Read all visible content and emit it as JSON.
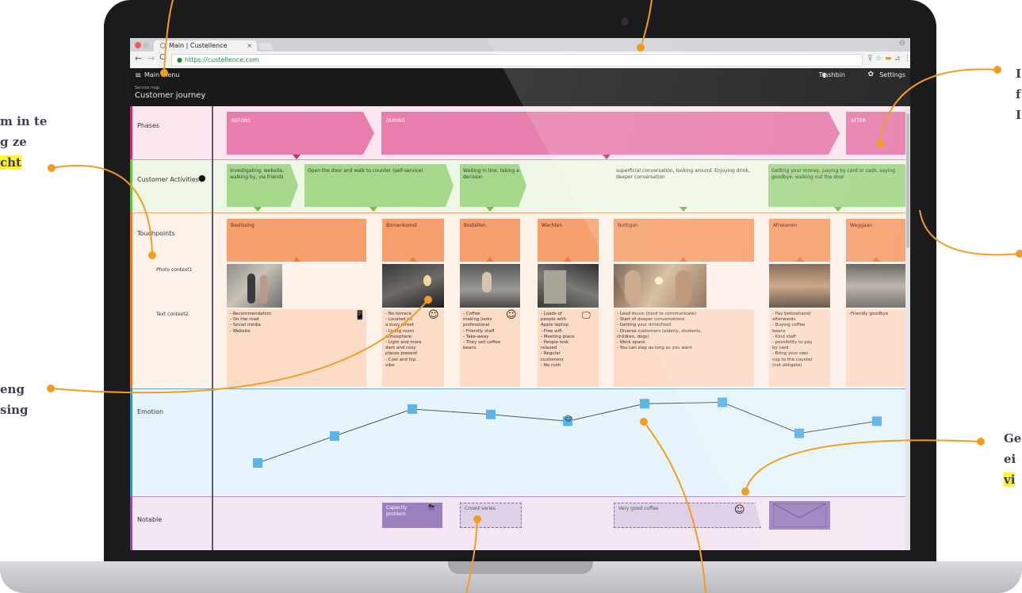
{
  "browser": {
    "tab_title": "Main | Custellence",
    "tab_close": "×",
    "url": "https://custellence.com",
    "profile_icon": "⊖",
    "nav_back": "←",
    "nav_forward": "→",
    "nav_reload": "C",
    "lock": "🔒",
    "ext_icons": [
      "⊽",
      "☆",
      "▬",
      "⊿",
      "⋮"
    ]
  },
  "app": {
    "menu_icon": "≡",
    "menu_label": "Main menu",
    "trash_icon": "▮",
    "trash_label": "Trashbin",
    "gear_icon": "✿",
    "settings_label": "Settings",
    "breadcrumb": "Service map",
    "page_title": "Customer journey"
  },
  "rows": {
    "phases": "Phases",
    "activities": "Customer Activities",
    "touchpoints": "Touchpoints",
    "photo_context": "Photo context1",
    "text_context": "Text context2",
    "emotion": "Emotion",
    "notable": "Notable"
  },
  "phases": [
    "BEFORE",
    "DURING",
    "AFTER"
  ],
  "activities": [
    "Investigating, website, walking by, via friends",
    "Open the door and walk to counter (self-service)",
    "Waiting in line, taking a decision",
    "superficial conversation, looking around. Enjoying drink, deeper conversation",
    "Getting your money, paying by card or cash, saying goodbye, walking out the door"
  ],
  "touchpoints": [
    {
      "title": "Beslissing",
      "icon": "📱",
      "text": "- Recommendation\n- On the road\n- Social media\n- Website"
    },
    {
      "title": "Binnenkomst",
      "icon": "☺",
      "text": "- No terrace\n- Located on\na busy street\n- Living room\natmosphere\n- Light and more\ndark and cosy\nplaces present\n- Cool and hip\nvibe"
    },
    {
      "title": "Bestellen",
      "icon": "☺",
      "text": "- Coffee\nmaking looks\nprofessional\n- Friendly staff\n- Take-away\n- They sell coffee\nbeans"
    },
    {
      "title": "Wachten",
      "icon": "🖵",
      "text": "- Loads of\npeople with\nApple laptop\n- Free wifi\n- Meeting place\n- People look\nrelaxed\n- Regular\ncustomers\n- No rush"
    },
    {
      "title": "Nuttigen",
      "icon": "",
      "text": "- Loud music (hard to communicate)\n- Start of deeper conversations\n- Getting your drink/food\n- Diverse customers (elderly, students,\nchildren, dogs)\n- Work space\n- You can stay as long as you want"
    },
    {
      "title": "Afrekenen",
      "icon": "",
      "text": "- Pay beforehand/\nafterwards\n- Buying coffee\nbeans\n- Kind staff\n- possibility to pay\nby card\n- Bring your own\ncup to the counter\n(not obligate)"
    },
    {
      "title": "Weggaan",
      "icon": "",
      "text": "-Friendly goodbye"
    }
  ],
  "emotion": {
    "values": [
      1,
      2,
      3,
      2.8,
      2.55,
      3.2,
      3.25,
      2.1,
      2.55
    ],
    "smiley": "☺"
  },
  "notable": [
    {
      "text": "Capacity problem",
      "icon": "⛈"
    },
    {
      "text": "Crowd varies",
      "icon": ""
    },
    {
      "text": "Very good coffee",
      "icon": "☺"
    },
    {
      "text": "",
      "icon": "✉"
    }
  ],
  "annotations": {
    "left1": [
      "m in te",
      "g ze",
      "cht"
    ],
    "left2": [
      "eng",
      "sing"
    ],
    "right1": [
      "I",
      "f",
      "I"
    ],
    "right2": [
      "Ge",
      "ei",
      "vi"
    ]
  },
  "colors": {
    "phase": "#e77ead",
    "activity": "#a6d78a",
    "touchpoint": "#f6a06e",
    "emotion_bg": "#e6f5fb",
    "emotion_marker": "#5ab4e6",
    "notable_bg": "#f2e7f2",
    "callout": "#f39c24",
    "highlight": "#fff336"
  }
}
